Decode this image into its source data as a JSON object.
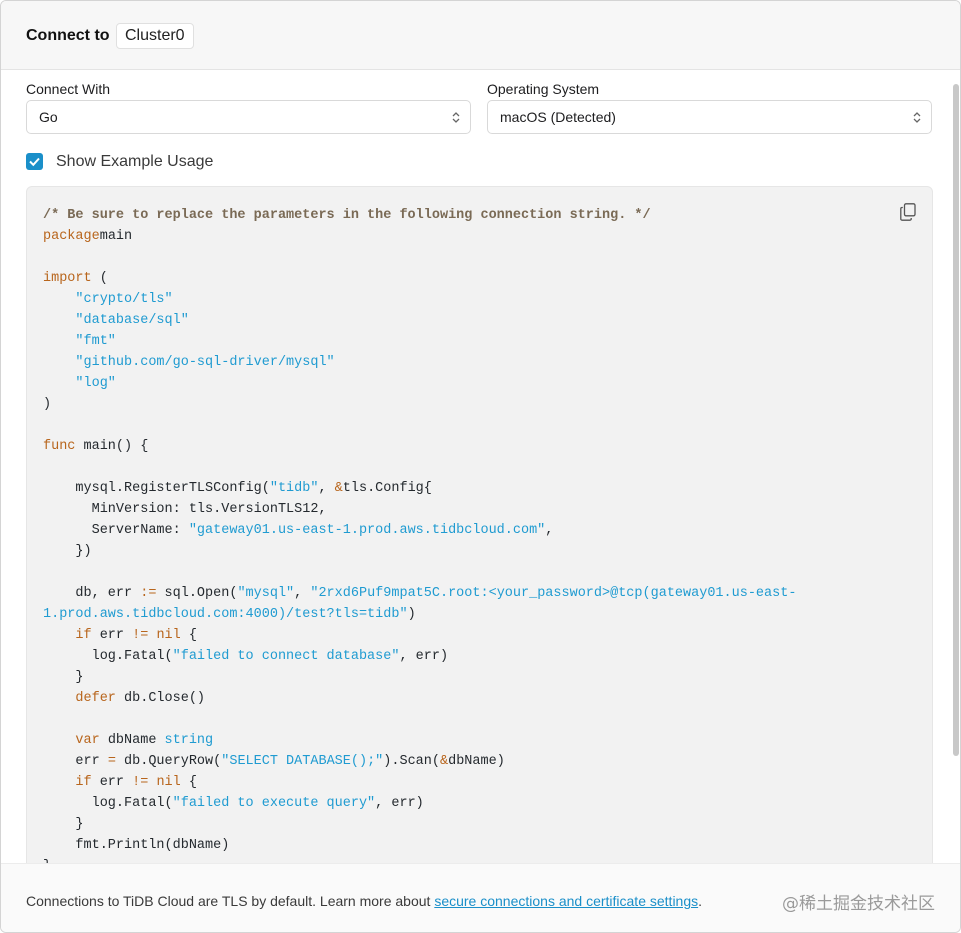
{
  "header": {
    "title": "Connect to",
    "cluster": "Cluster0"
  },
  "connect_with": {
    "label": "Connect With",
    "value": "Go"
  },
  "operating_system": {
    "label": "Operating System",
    "value": "macOS (Detected)"
  },
  "example_usage": {
    "label": "Show Example Usage",
    "checked": true
  },
  "code": {
    "copy_icon": "copy-icon",
    "lines": [
      [
        [
          "cm",
          "/* Be sure to replace the parameters in the following connection string. */"
        ]
      ],
      [
        [
          "kw",
          "package"
        ],
        [
          "",
          "main"
        ]
      ],
      [],
      [
        [
          "kw",
          "import"
        ],
        [
          "",
          " ("
        ]
      ],
      [
        [
          "",
          "    "
        ],
        [
          "st",
          "\"crypto/tls\""
        ]
      ],
      [
        [
          "",
          "    "
        ],
        [
          "st",
          "\"database/sql\""
        ]
      ],
      [
        [
          "",
          "    "
        ],
        [
          "st",
          "\"fmt\""
        ]
      ],
      [
        [
          "",
          "    "
        ],
        [
          "st",
          "\"github.com/go-sql-driver/mysql\""
        ]
      ],
      [
        [
          "",
          "    "
        ],
        [
          "st",
          "\"log\""
        ]
      ],
      [
        [
          "",
          ")"
        ]
      ],
      [],
      [
        [
          "kw",
          "func"
        ],
        [
          "",
          " main() {"
        ]
      ],
      [],
      [
        [
          "",
          "    mysql.RegisterTLSConfig("
        ],
        [
          "st",
          "\"tidb\""
        ],
        [
          "",
          ", "
        ],
        [
          "op",
          "&"
        ],
        [
          "",
          "tls.Config{"
        ]
      ],
      [
        [
          "",
          "      MinVersion: tls.VersionTLS12,"
        ]
      ],
      [
        [
          "",
          "      ServerName: "
        ],
        [
          "st",
          "\"gateway01.us-east-1.prod.aws.tidbcloud.com\""
        ],
        [
          "",
          ","
        ]
      ],
      [
        [
          "",
          "    })"
        ]
      ],
      [],
      [
        [
          "",
          "    db, err "
        ],
        [
          "op",
          ":="
        ],
        [
          "",
          " sql.Open("
        ],
        [
          "st",
          "\"mysql\""
        ],
        [
          "",
          ", "
        ],
        [
          "st",
          "\"2rxd6Puf9mpat5C.root:<your_password>@tcp(gateway01.us-east-"
        ]
      ],
      [
        [
          "st",
          "1.prod.aws.tidbcloud.com:4000)/test?tls=tidb\""
        ],
        [
          "",
          ")"
        ]
      ],
      [
        [
          "",
          "    "
        ],
        [
          "kw",
          "if"
        ],
        [
          "",
          " err "
        ],
        [
          "op",
          "!="
        ],
        [
          "",
          " "
        ],
        [
          "kw",
          "nil"
        ],
        [
          "",
          " {"
        ]
      ],
      [
        [
          "",
          "      log.Fatal("
        ],
        [
          "st",
          "\"failed to connect database\""
        ],
        [
          "",
          ", err)"
        ]
      ],
      [
        [
          "",
          "    }"
        ]
      ],
      [
        [
          "",
          "    "
        ],
        [
          "kw",
          "defer"
        ],
        [
          "",
          " db.Close()"
        ]
      ],
      [],
      [
        [
          "",
          "    "
        ],
        [
          "kw",
          "var"
        ],
        [
          "",
          " dbName "
        ],
        [
          "st",
          "string"
        ]
      ],
      [
        [
          "",
          "    err "
        ],
        [
          "op",
          "="
        ],
        [
          "",
          " db.QueryRow("
        ],
        [
          "st",
          "\"SELECT DATABASE();\""
        ],
        [
          "",
          ").Scan("
        ],
        [
          "op",
          "&"
        ],
        [
          "",
          "dbName)"
        ]
      ],
      [
        [
          "",
          "    "
        ],
        [
          "kw",
          "if"
        ],
        [
          "",
          " err "
        ],
        [
          "op",
          "!="
        ],
        [
          "",
          " "
        ],
        [
          "kw",
          "nil"
        ],
        [
          "",
          " {"
        ]
      ],
      [
        [
          "",
          "      log.Fatal("
        ],
        [
          "st",
          "\"failed to execute query\""
        ],
        [
          "",
          ", err)"
        ]
      ],
      [
        [
          "",
          "    }"
        ]
      ],
      [
        [
          "",
          "    fmt.Println(dbName)"
        ]
      ],
      [
        [
          "",
          "}"
        ]
      ]
    ]
  },
  "footer": {
    "text": "Connections to TiDB Cloud are TLS by default. Learn more about ",
    "link": "secure connections and certificate settings",
    "suffix": ".",
    "watermark": "@稀土掘金技术社区"
  },
  "colors": {
    "accent": "#1a8fc9",
    "keyword": "#b8651c",
    "string": "#1f9bd1",
    "comment": "#7a6a55"
  }
}
